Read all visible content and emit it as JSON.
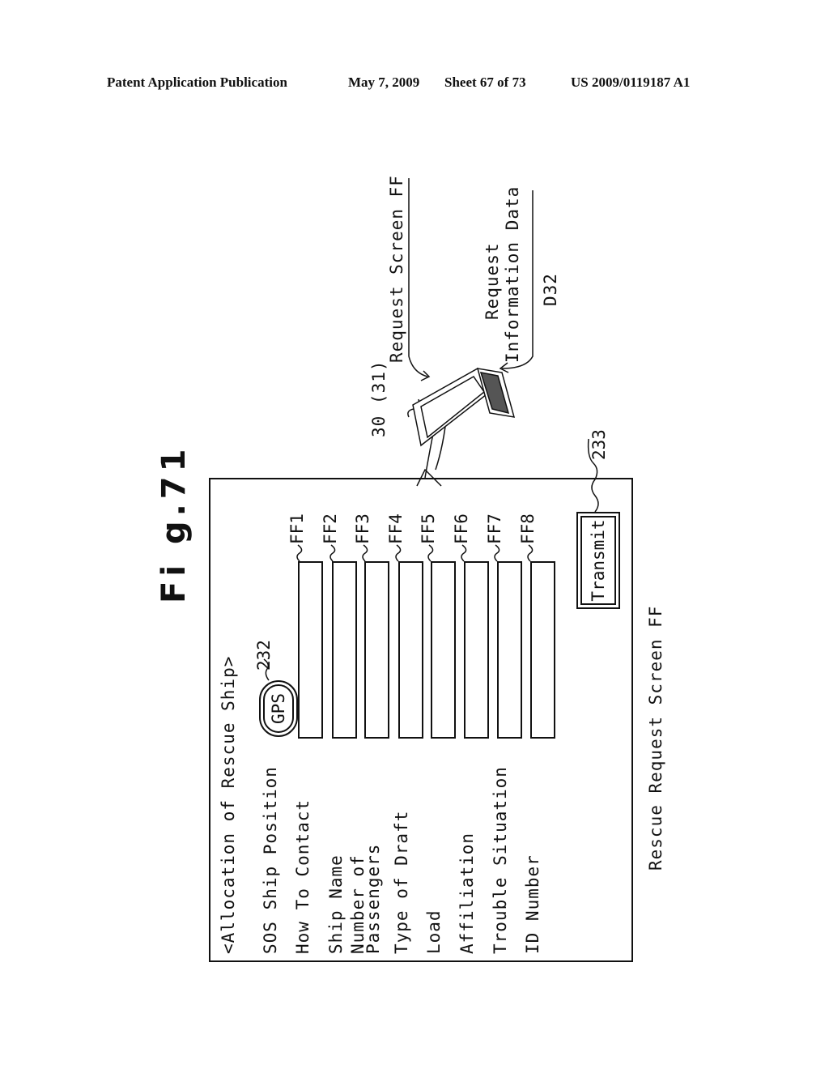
{
  "header": {
    "publication": "Patent Application Publication",
    "date": "May 7, 2009",
    "sheet": "Sheet 67 of 73",
    "number": "US 2009/0119187 A1"
  },
  "figure": {
    "title": "Fi g.71",
    "caption": "Rescue Request Screen FF",
    "screen": {
      "heading": "<Allocation of Rescue Ship>",
      "gps_button": {
        "label": "GPS",
        "ref": "232"
      },
      "fields": [
        {
          "label": "SOS Ship Position",
          "label2": ""
        },
        {
          "label": "How To Contact",
          "ref": "FF1"
        },
        {
          "label": "Ship Name",
          "ref": "FF2"
        },
        {
          "label": "Number of",
          "label2": "Passengers",
          "ref": "FF3"
        },
        {
          "label": "Type of Draft",
          "ref": "FF4"
        },
        {
          "label": "Load",
          "ref": "FF5"
        },
        {
          "label": "Affiliation",
          "ref": "FF6"
        },
        {
          "label": "Trouble Situation",
          "ref": "FF7"
        },
        {
          "label": "ID Number",
          "ref": "FF8"
        }
      ],
      "transmit_button": {
        "label": "Transmit",
        "ref": "233"
      }
    },
    "terminal": {
      "ref": "30 (31)",
      "request_screen_label": "Request Screen FF",
      "request_info_label_line1": "Request",
      "request_info_label_line2": "Information Data",
      "request_info_ref": "D32"
    }
  }
}
